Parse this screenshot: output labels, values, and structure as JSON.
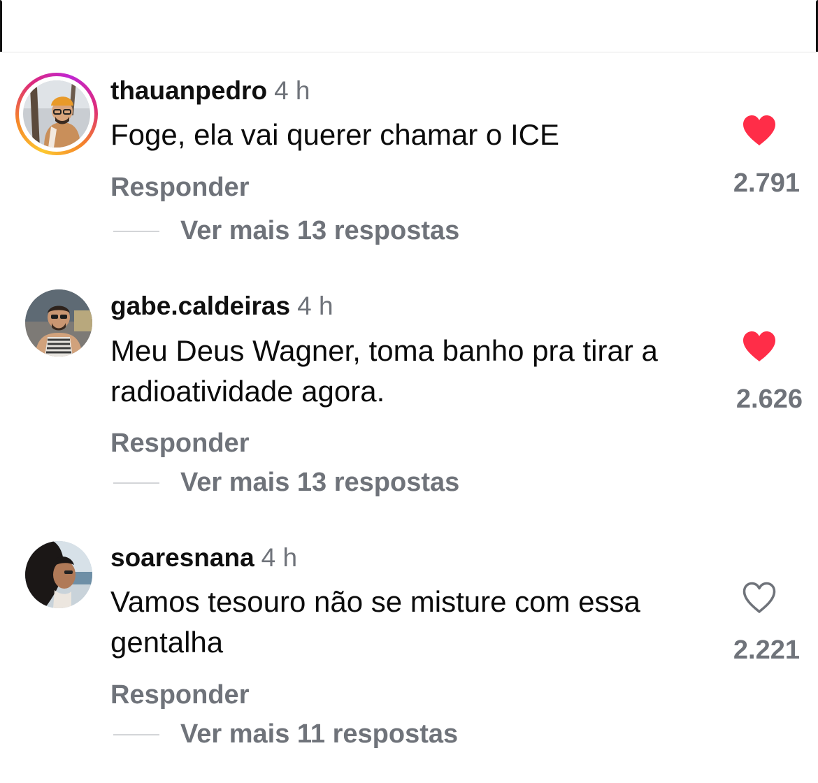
{
  "colors": {
    "liked": "#ff2d48",
    "secondary_text": "#6f737a",
    "primary_text": "#0b0b0b"
  },
  "comments": [
    {
      "username": "thauanpedro",
      "time": "4 h",
      "text": "Foge, ela vai querer chamar o ICE",
      "reply_label": "Responder",
      "more_replies": "Ver mais 13 respostas",
      "likes": "2.791",
      "liked": true,
      "icon": "heart-filled-icon",
      "has_story_ring": true
    },
    {
      "username": "gabe.caldeiras",
      "time": "4 h",
      "text": "Meu Deus Wagner, toma banho pra tirar a radioatividade agora.",
      "reply_label": "Responder",
      "more_replies": "Ver mais 13 respostas",
      "likes": "2.626",
      "liked": true,
      "icon": "heart-filled-icon",
      "has_story_ring": false
    },
    {
      "username": "soaresnana",
      "time": "4 h",
      "text": "Vamos tesouro não se misture com essa gentalha",
      "reply_label": "Responder",
      "more_replies": "Ver mais 11 respostas",
      "likes": "2.221",
      "liked": false,
      "icon": "heart-outline-icon",
      "has_story_ring": false
    }
  ]
}
